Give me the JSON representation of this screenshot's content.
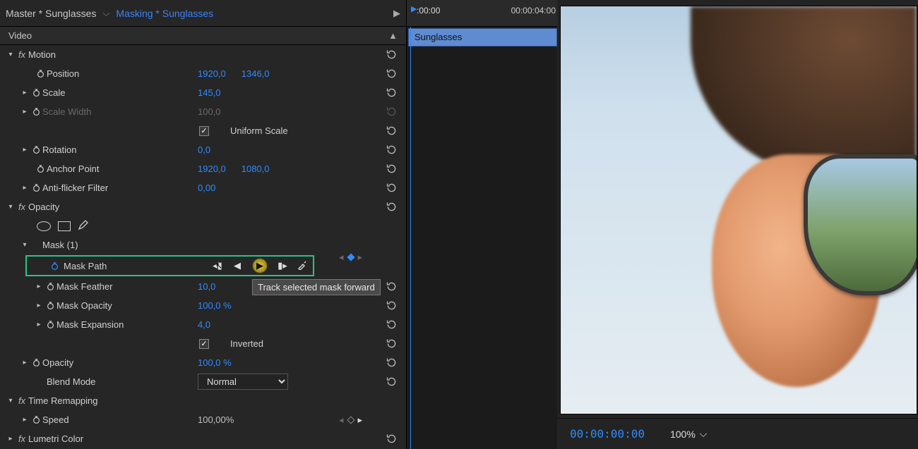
{
  "tabs": {
    "master": "Master * Sunglasses",
    "masking": "Masking * Sunglasses"
  },
  "section_header": "Video",
  "timeline": {
    "start": ":00:00",
    "end": "00:00:04:00",
    "clip_name": "Sunglasses"
  },
  "motion": {
    "label": "Motion",
    "position": {
      "label": "Position",
      "x": "1920,0",
      "y": "1346,0"
    },
    "scale": {
      "label": "Scale",
      "value": "145,0"
    },
    "scale_width": {
      "label": "Scale Width",
      "value": "100,0"
    },
    "uniform": {
      "label": "Uniform Scale"
    },
    "rotation": {
      "label": "Rotation",
      "value": "0,0"
    },
    "anchor": {
      "label": "Anchor Point",
      "x": "1920,0",
      "y": "1080,0"
    },
    "antiflicker": {
      "label": "Anti-flicker Filter",
      "value": "0,00"
    }
  },
  "opacity": {
    "label": "Opacity",
    "mask_group": "Mask (1)",
    "mask_path": {
      "label": "Mask Path"
    },
    "feather": {
      "label": "Mask Feather",
      "value": "10,0"
    },
    "mask_opacity": {
      "label": "Mask Opacity",
      "value": "100,0 %"
    },
    "expansion": {
      "label": "Mask Expansion",
      "value": "4,0"
    },
    "inverted": {
      "label": "Inverted"
    },
    "opacity_val": {
      "label": "Opacity",
      "value": "100,0 %"
    },
    "blend": {
      "label": "Blend Mode",
      "value": "Normal"
    }
  },
  "time_remap": {
    "label": "Time Remapping",
    "speed_label": "Speed",
    "speed_value": "100,00%"
  },
  "lumetri": {
    "label": "Lumetri Color"
  },
  "tooltip": "Track selected mask forward",
  "preview": {
    "timecode": "00:00:00:00",
    "zoom": "100%"
  }
}
